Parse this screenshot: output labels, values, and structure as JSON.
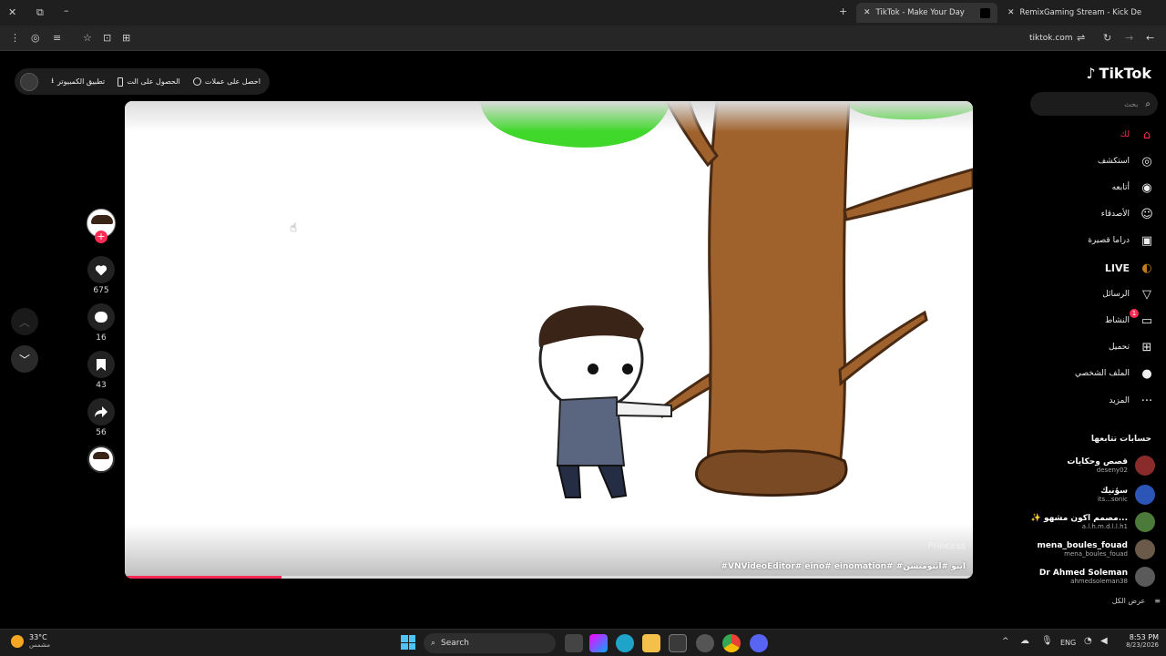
{
  "browser": {
    "tabs": [
      {
        "title": "TikTok - Make Your Day",
        "active": true
      },
      {
        "title": "RemixGaming Stream - Kick De",
        "active": false
      }
    ],
    "url": "tiktok.com"
  },
  "topbar": {
    "item1": "احصل على عملات",
    "item2": "الحصول على الت",
    "item3": "تطبيق الكمبيوتر"
  },
  "video": {
    "author_watermark": "Princess",
    "caption": "#VNVideoEditor# eino# einomation# #اينو #اينوميشن",
    "progress_fraction": 0.185
  },
  "actions": {
    "likes": "675",
    "comments": "16",
    "saves": "43",
    "shares": "56"
  },
  "sidebar": {
    "logo": "TikTok",
    "search_placeholder": "بحث",
    "nav": [
      {
        "label": "لك",
        "icon": "home-icon"
      },
      {
        "label": "استكشف",
        "icon": "compass-icon"
      },
      {
        "label": "أتابعه",
        "icon": "following-icon"
      },
      {
        "label": "الأصدقاء",
        "icon": "friends-icon"
      },
      {
        "label": "دراما قصيرة",
        "icon": "drama-icon"
      },
      {
        "label": "LIVE",
        "icon": "live-icon"
      },
      {
        "label": "الرسائل",
        "icon": "messages-icon"
      },
      {
        "label": "النشاط",
        "icon": "activity-icon"
      },
      {
        "label": "تحميل",
        "icon": "upload-icon"
      },
      {
        "label": "الملف الشخصي",
        "icon": "profile-icon"
      },
      {
        "label": "المزيد",
        "icon": "more-icon"
      }
    ],
    "activity_badge": "1",
    "following_title": "حسابات تتابعها",
    "following": [
      {
        "name": "قصص وحكايات",
        "handle": "deseny02",
        "color": "#8a2b2b"
      },
      {
        "name": "سؤنيك",
        "handle": "its...sonic",
        "color": "#2b56b8"
      },
      {
        "name": "✨ مصمم اكون مشهو...",
        "handle": "a.l.h.m.d.l.l.h1",
        "color": "#4c7a3a"
      },
      {
        "name": "mena_boules_fouad",
        "handle": "mena_boules_fouad",
        "color": "#6b5a4a"
      },
      {
        "name": "Dr Ahmed Soleman",
        "handle": "ahmedsoleman38",
        "color": "#5a5a5a"
      }
    ],
    "see_all": "عرض الكل"
  },
  "taskbar": {
    "weather_temp": "33°C",
    "weather_desc": "مشمس",
    "search_label": "Search",
    "lang": "ENG",
    "time": "8:53 PM",
    "date": "8/23/2026"
  }
}
